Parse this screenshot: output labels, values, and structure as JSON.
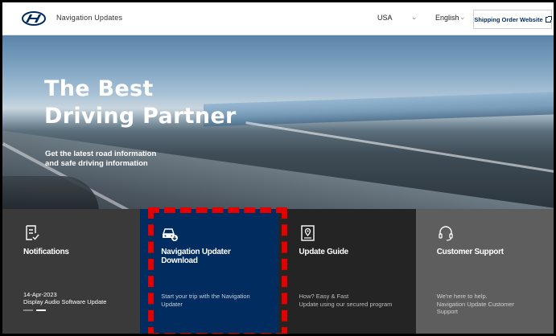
{
  "header": {
    "brand_title": "Navigation Updates",
    "country": "USA",
    "language": "English",
    "shipping_button": "Shipping Order Website"
  },
  "hero": {
    "title_line1": "The Best",
    "title_line2": "Driving Partner",
    "subtitle_line1": "Get the latest road information",
    "subtitle_line2": "and safe driving information"
  },
  "cards": [
    {
      "title": "Notifications",
      "date": "14-Apr-2023",
      "text": "Display Audio Software Update",
      "icon": "document-check-icon"
    },
    {
      "title_line1": "Navigation Updater",
      "title_line2": "Download",
      "desc_line1": "Start your trip with the Navigation",
      "desc_line2": "Updater",
      "icon": "car-download-icon"
    },
    {
      "title": "Update Guide",
      "desc_line1": "How? Easy & Fast",
      "desc_line2": "Update using our secured program",
      "icon": "map-pin-guide-icon"
    },
    {
      "title": "Customer Support",
      "desc_line1": "We're here to help.",
      "desc_line2": "Navigation Update Customer",
      "desc_line3": "Support",
      "icon": "headset-icon"
    }
  ],
  "colors": {
    "brand_blue": "#002c5f",
    "highlight_red": "#e30000"
  }
}
